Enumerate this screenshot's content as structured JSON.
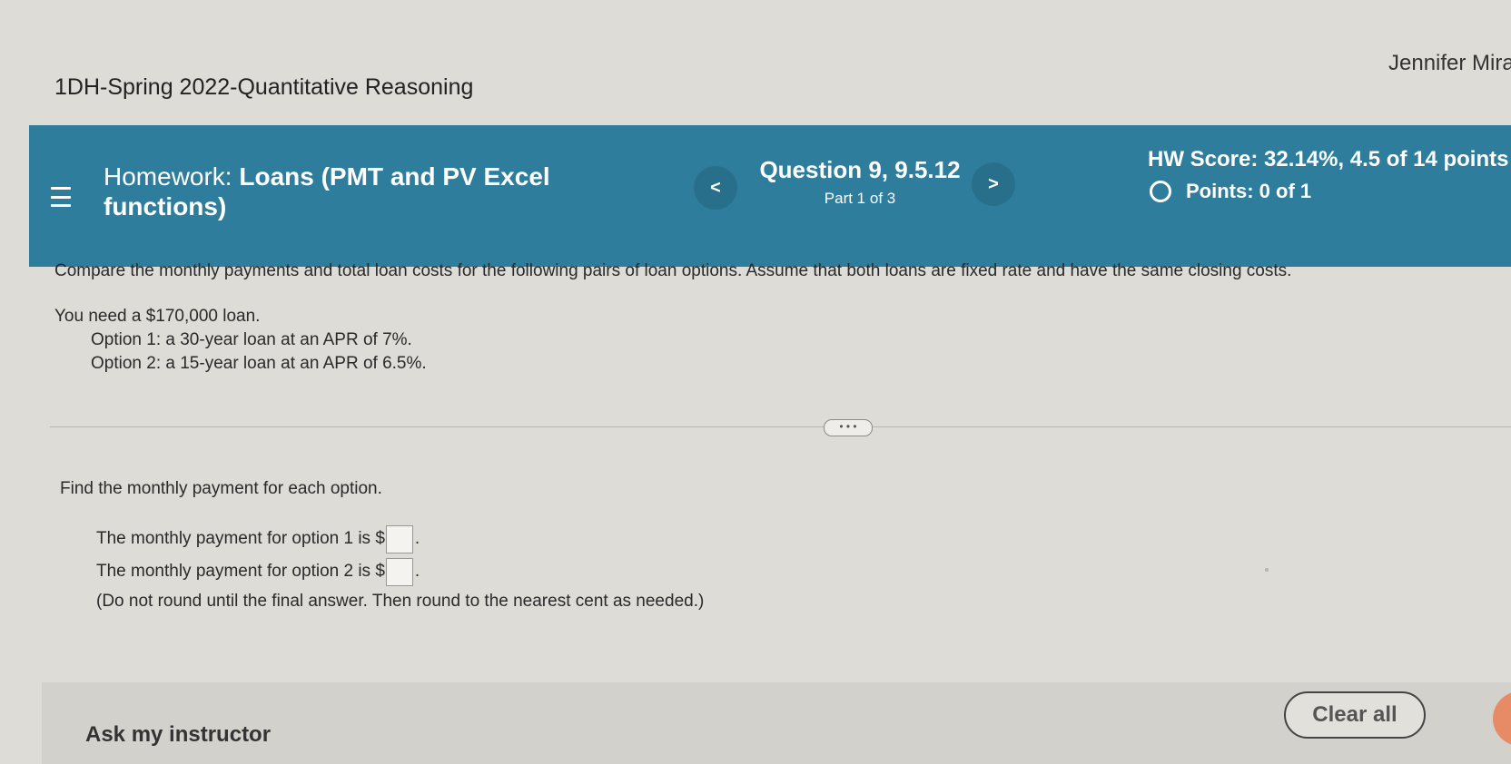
{
  "header": {
    "course_title": "1DH-Spring 2022-Quantitative Reasoning",
    "user_name": "Jennifer Mira"
  },
  "topbar": {
    "homework_label": "Homework:",
    "homework_name": "Loans (PMT and PV Excel functions)",
    "prev_symbol": "<",
    "next_symbol": ">",
    "question_title": "Question 9, 9.5.12",
    "question_part": "Part 1 of 3",
    "hw_score": "HW Score: 32.14%, 4.5 of 14 points",
    "points": "Points: 0 of 1"
  },
  "problem": {
    "statement": "Compare the monthly payments and total loan costs for the following pairs of loan options. Assume that both loans are fixed rate and have the same closing costs.",
    "loan": "You need a $170,000 loan.",
    "option1": "Option 1: a 30-year loan at an APR of 7%.",
    "option2": "Option 2: a 15-year loan at an APR of 6.5%."
  },
  "expand_label": "• • •",
  "question": {
    "prompt": "Find the monthly payment for each option.",
    "answer1_prefix": "The monthly payment for option 1 is $",
    "answer2_prefix": "The monthly payment for option 2 is $",
    "answer_suffix": ".",
    "note": "(Do not round until the final answer. Then round to the nearest cent as needed.)"
  },
  "footer": {
    "ask_instructor": "Ask my instructor",
    "clear_all": "Clear all"
  },
  "colors": {
    "topbar": "#2e7d9c",
    "background": "#dedcd6"
  },
  "icons": {
    "menu": "hamburger-icon",
    "points_status": "circle-outline-icon"
  }
}
